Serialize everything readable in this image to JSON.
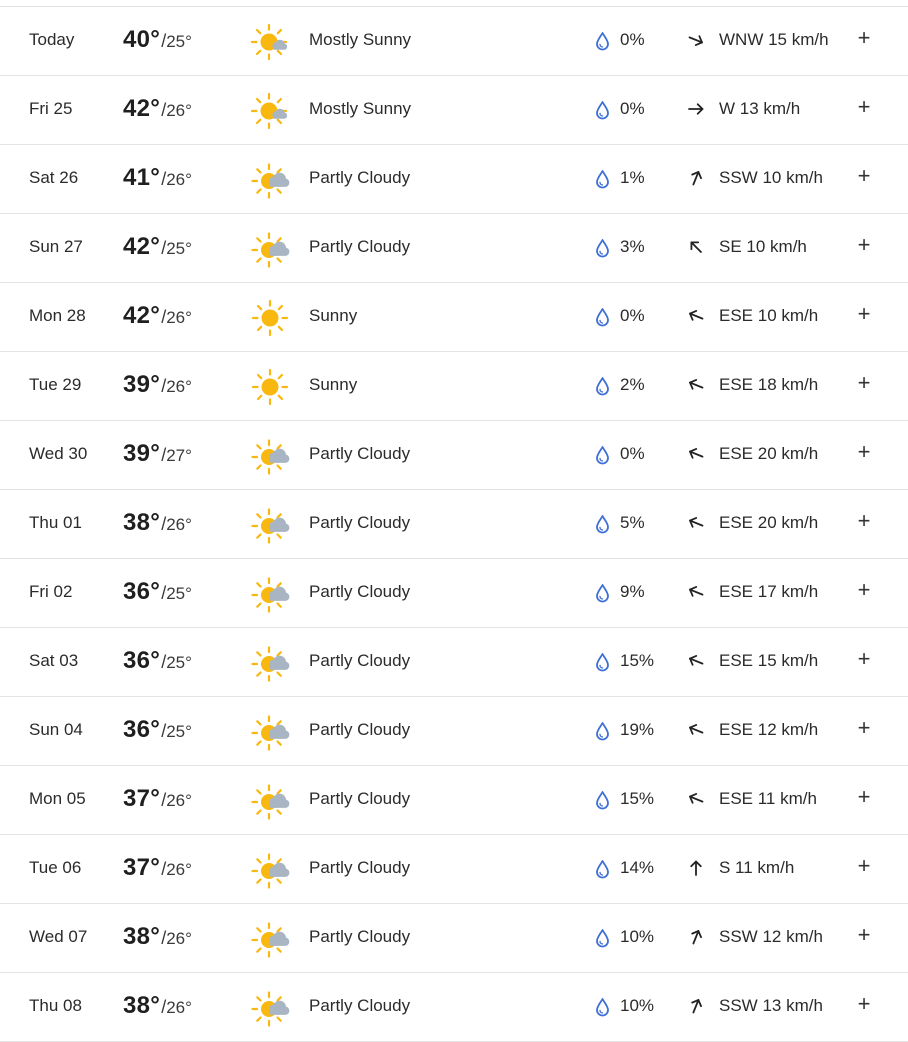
{
  "forecast": [
    {
      "day": "Today",
      "high": "40°",
      "low": "25°",
      "icon": "mostly-sunny-icon",
      "condition": "Mostly Sunny",
      "precip": "0%",
      "wind_dir_deg": 112,
      "wind": "WNW 15 km/h"
    },
    {
      "day": "Fri 25",
      "high": "42°",
      "low": "26°",
      "icon": "mostly-sunny-icon",
      "condition": "Mostly Sunny",
      "precip": "0%",
      "wind_dir_deg": 90,
      "wind": "W 13 km/h"
    },
    {
      "day": "Sat 26",
      "high": "41°",
      "low": "26°",
      "icon": "partly-cloudy-icon",
      "condition": "Partly Cloudy",
      "precip": "1%",
      "wind_dir_deg": 22,
      "wind": "SSW 10 km/h"
    },
    {
      "day": "Sun 27",
      "high": "42°",
      "low": "25°",
      "icon": "partly-cloudy-icon",
      "condition": "Partly Cloudy",
      "precip": "3%",
      "wind_dir_deg": 315,
      "wind": "SE 10 km/h"
    },
    {
      "day": "Mon 28",
      "high": "42°",
      "low": "26°",
      "icon": "sunny-icon",
      "condition": "Sunny",
      "precip": "0%",
      "wind_dir_deg": 292,
      "wind": "ESE 10 km/h"
    },
    {
      "day": "Tue 29",
      "high": "39°",
      "low": "26°",
      "icon": "sunny-icon",
      "condition": "Sunny",
      "precip": "2%",
      "wind_dir_deg": 292,
      "wind": "ESE 18 km/h"
    },
    {
      "day": "Wed 30",
      "high": "39°",
      "low": "27°",
      "icon": "partly-cloudy-icon",
      "condition": "Partly Cloudy",
      "precip": "0%",
      "wind_dir_deg": 292,
      "wind": "ESE 20 km/h"
    },
    {
      "day": "Thu 01",
      "high": "38°",
      "low": "26°",
      "icon": "partly-cloudy-icon",
      "condition": "Partly Cloudy",
      "precip": "5%",
      "wind_dir_deg": 292,
      "wind": "ESE 20 km/h"
    },
    {
      "day": "Fri 02",
      "high": "36°",
      "low": "25°",
      "icon": "partly-cloudy-icon",
      "condition": "Partly Cloudy",
      "precip": "9%",
      "wind_dir_deg": 292,
      "wind": "ESE 17 km/h"
    },
    {
      "day": "Sat 03",
      "high": "36°",
      "low": "25°",
      "icon": "partly-cloudy-icon",
      "condition": "Partly Cloudy",
      "precip": "15%",
      "wind_dir_deg": 292,
      "wind": "ESE 15 km/h"
    },
    {
      "day": "Sun 04",
      "high": "36°",
      "low": "25°",
      "icon": "partly-cloudy-icon",
      "condition": "Partly Cloudy",
      "precip": "19%",
      "wind_dir_deg": 292,
      "wind": "ESE 12 km/h"
    },
    {
      "day": "Mon 05",
      "high": "37°",
      "low": "26°",
      "icon": "partly-cloudy-icon",
      "condition": "Partly Cloudy",
      "precip": "15%",
      "wind_dir_deg": 292,
      "wind": "ESE 11 km/h"
    },
    {
      "day": "Tue 06",
      "high": "37°",
      "low": "26°",
      "icon": "partly-cloudy-icon",
      "condition": "Partly Cloudy",
      "precip": "14%",
      "wind_dir_deg": 0,
      "wind": "S 11 km/h"
    },
    {
      "day": "Wed 07",
      "high": "38°",
      "low": "26°",
      "icon": "partly-cloudy-icon",
      "condition": "Partly Cloudy",
      "precip": "10%",
      "wind_dir_deg": 22,
      "wind": "SSW 12 km/h"
    },
    {
      "day": "Thu 08",
      "high": "38°",
      "low": "26°",
      "icon": "partly-cloudy-icon",
      "condition": "Partly Cloudy",
      "precip": "10%",
      "wind_dir_deg": 22,
      "wind": "SSW 13 km/h"
    }
  ],
  "ui": {
    "separator": "/",
    "expand_symbol": "+",
    "drop_icon": "raindrop-icon",
    "arrow_icon": "wind-direction-arrow-icon"
  },
  "colors": {
    "sun": "#F9B80F",
    "cloud": "#A9B5C3",
    "drop": "#3E6FD8",
    "divider": "#E3E3E3",
    "text": "#1F1F1F"
  }
}
